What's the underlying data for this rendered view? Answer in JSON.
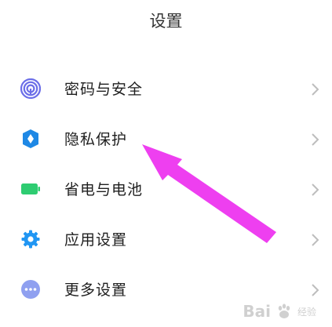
{
  "header": {
    "title": "设置"
  },
  "settings": {
    "items": [
      {
        "label": "密码与安全",
        "icon": "fingerprint-icon",
        "color": "#6b6ee8"
      },
      {
        "label": "隐私保护",
        "icon": "privacy-shield-icon",
        "color": "#1e88e5"
      },
      {
        "label": "省电与电池",
        "icon": "battery-icon",
        "color": "#2ecc71"
      },
      {
        "label": "应用设置",
        "icon": "gear-icon",
        "color": "#2196f3"
      },
      {
        "label": "更多设置",
        "icon": "more-dots-icon",
        "color": "#8fa0f0"
      }
    ]
  },
  "annotation": {
    "arrow_color": "#ee3ff0"
  },
  "watermark": {
    "brand": "Bai",
    "suffix": "经验"
  }
}
